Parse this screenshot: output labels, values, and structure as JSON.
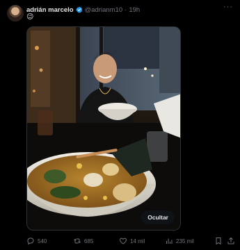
{
  "post": {
    "author_name": "adrián marcelo",
    "handle": "@adrianm10",
    "separator": "·",
    "time": "19h",
    "text": "😉",
    "more_label": "···",
    "media_button": "Ocultar"
  },
  "actions": {
    "replies": "540",
    "reposts": "685",
    "likes": "14 mil",
    "views": "235 mil"
  },
  "colors": {
    "verified": "#1d9bf0",
    "muted": "#71767b",
    "background": "#000000"
  },
  "icons": {
    "reply": "reply-icon",
    "repost": "repost-icon",
    "like": "heart-icon",
    "views": "views-icon",
    "bookmark": "bookmark-icon",
    "share": "share-icon"
  }
}
